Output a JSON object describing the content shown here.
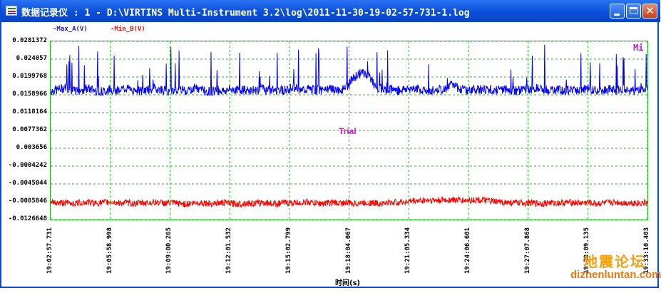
{
  "window": {
    "title": "数据记录仪 : 1 - D:\\VIRTINS Multi-Instrument 3.2\\log\\2011-11-30-19-02-57-731-1.log",
    "controls": {
      "minimize": "minimize-icon",
      "maximize": "maximize-icon",
      "close": "✕"
    }
  },
  "legend": {
    "max_a": "-Max_A(V)",
    "min_b": "-Min_B(V)"
  },
  "overlay": {
    "trial": "Trial",
    "mi": "Mi"
  },
  "watermark": {
    "line1": "地震论坛",
    "line2": "dizhenluntan.com"
  },
  "colors": {
    "max_a": "#0000ff",
    "min_b": "#ff0000",
    "grid": "#20c020",
    "frame": "#0a49d9"
  },
  "chart_data": {
    "type": "line",
    "xlabel": "时间(s)",
    "ylabel": "",
    "grid": true,
    "ylim": [
      -0.0126648,
      0.0281372
    ],
    "y_ticks": [
      "0.0281372",
      "0.024057",
      "0.0199768",
      "0.0158966",
      "0.0118164",
      "0.0077362",
      "0.003656",
      "-0.0004242",
      "-0.0045044",
      "-0.0085846",
      "-0.0126648"
    ],
    "x_ticks": [
      "19:02:57.731",
      "19:05:58.998",
      "19:09:00.265",
      "19:12:01.532",
      "19:15:02.799",
      "19:18:04.067",
      "19:21:05.334",
      "19:24:06.601",
      "19:27:07.868",
      "19:30:09.135",
      "19:33:10.403"
    ],
    "series": [
      {
        "name": "Max_A(V)",
        "color": "#0000ff",
        "baseline": 0.0165,
        "spread": 0.001,
        "spike_max": 0.0275,
        "values": [
          0.0168,
          0.0171,
          0.0176,
          0.0167,
          0.017,
          0.0173,
          0.0169,
          0.0166,
          0.0172,
          0.017,
          0.0175,
          0.0169,
          0.0167,
          0.0171,
          0.0173,
          0.017,
          0.0168,
          0.0172,
          0.0169,
          0.0174,
          0.0171,
          0.0167,
          0.017,
          0.0168,
          0.0172,
          0.0171,
          0.0169,
          0.017,
          0.0173,
          0.0168,
          0.0171,
          0.017,
          0.0176,
          0.0169,
          0.0172,
          0.017,
          0.0168,
          0.0171,
          0.0169,
          0.0172,
          0.0195,
          0.021,
          0.0205,
          0.0178,
          0.017,
          0.0173,
          0.0169,
          0.0172,
          0.0175,
          0.0171,
          0.0168,
          0.017,
          0.0172,
          0.018,
          0.0175,
          0.0169,
          0.0171,
          0.017,
          0.0173,
          0.0169,
          0.0172,
          0.017,
          0.0168,
          0.0171,
          0.0174,
          0.017,
          0.0169,
          0.0172,
          0.017,
          0.0168,
          0.0171,
          0.0173,
          0.017,
          0.0169,
          0.0172,
          0.017,
          0.0171,
          0.0168,
          0.0172,
          0.0169
        ]
      },
      {
        "name": "Min_B(V)",
        "color": "#ff0000",
        "baseline": -0.0088,
        "spread": 0.0007,
        "values": [
          -0.0087,
          -0.0089,
          -0.0088,
          -0.009,
          -0.0088,
          -0.0087,
          -0.0089,
          -0.0088,
          -0.0086,
          -0.0089,
          -0.0088,
          -0.009,
          -0.0089,
          -0.0088,
          -0.0087,
          -0.0089,
          -0.0088,
          -0.009,
          -0.0091,
          -0.0089,
          -0.0088,
          -0.009,
          -0.0089,
          -0.0088,
          -0.009,
          -0.0091,
          -0.0089,
          -0.009,
          -0.0088,
          -0.0089,
          -0.009,
          -0.0088,
          -0.0089,
          -0.0088,
          -0.0087,
          -0.0089,
          -0.009,
          -0.0088,
          -0.0089,
          -0.0088,
          -0.009,
          -0.0089,
          -0.0088,
          -0.0089,
          -0.009,
          -0.0088,
          -0.0087,
          -0.0086,
          -0.0084,
          -0.0083,
          -0.0082,
          -0.0083,
          -0.0082,
          -0.0081,
          -0.0082,
          -0.0083,
          -0.0081,
          -0.0082,
          -0.0084,
          -0.0086,
          -0.0087,
          -0.0088,
          -0.0089,
          -0.0088,
          -0.0089,
          -0.009,
          -0.0088,
          -0.0089,
          -0.0088,
          -0.0087,
          -0.0089,
          -0.0088,
          -0.009,
          -0.0089,
          -0.0088,
          -0.0087,
          -0.0089,
          -0.0088,
          -0.0089,
          -0.0088
        ]
      }
    ]
  }
}
